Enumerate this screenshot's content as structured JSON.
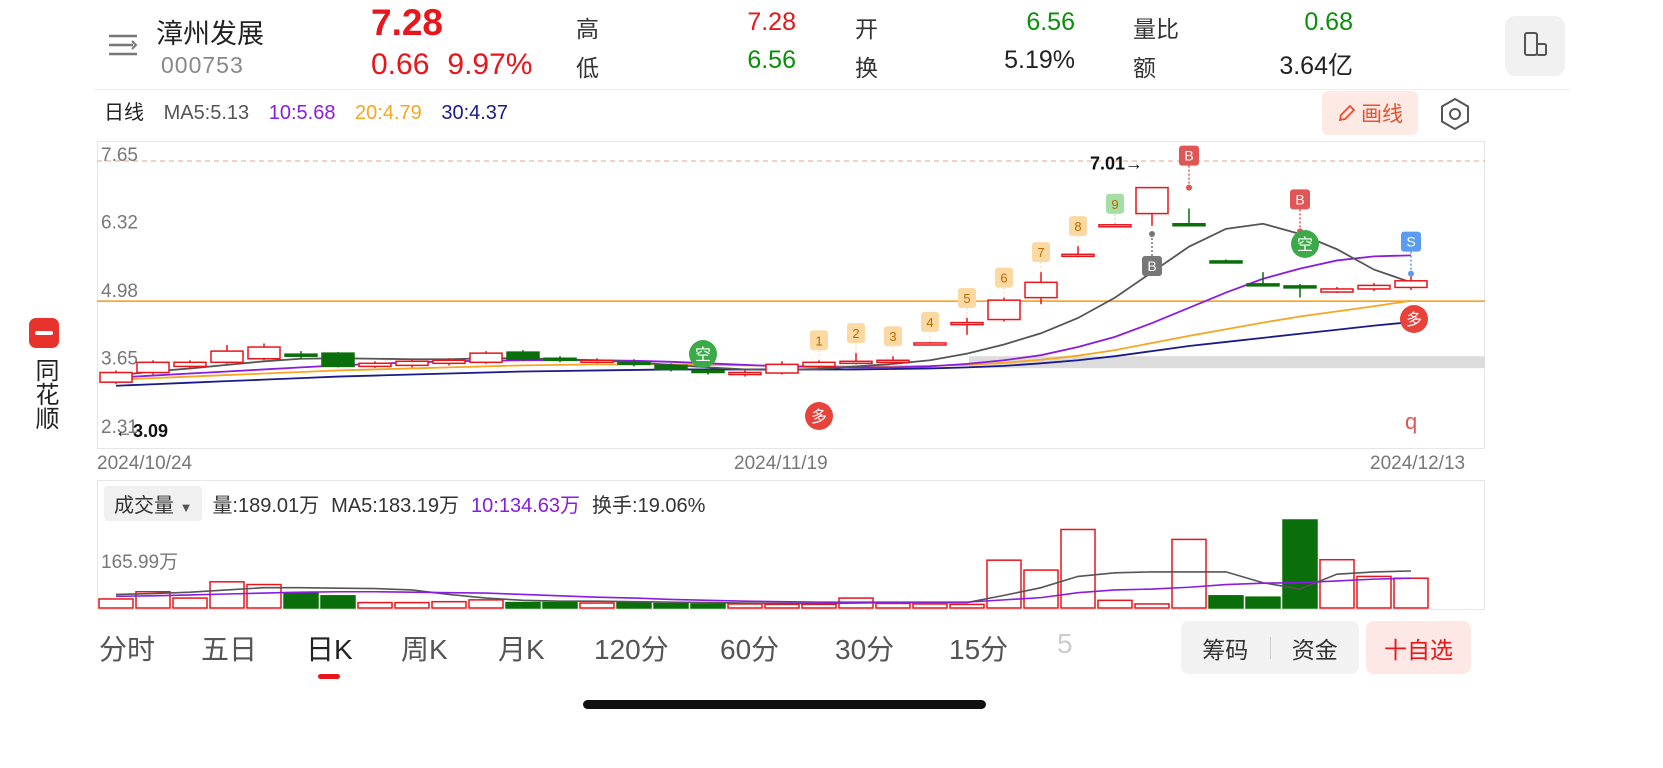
{
  "app": {
    "brand": "同花顺"
  },
  "stock": {
    "name": "漳州发展",
    "code": "000753",
    "price": "7.28",
    "change": "0.66",
    "change_pct": "9.97%",
    "quotes": [
      {
        "label": "高",
        "value": "7.28",
        "tone": "red"
      },
      {
        "label": "开",
        "value": "6.56",
        "tone": "green"
      },
      {
        "label": "量比",
        "value": "0.68",
        "tone": "green"
      },
      {
        "label": "低",
        "value": "6.56",
        "tone": "green"
      },
      {
        "label": "换",
        "value": "5.19%",
        "tone": "dark"
      },
      {
        "label": "额",
        "value": "3.64亿",
        "tone": "dark"
      }
    ]
  },
  "indicators": {
    "period_label": "日线",
    "ma5": "MA5:5.13",
    "ma10": "10:5.68",
    "ma20": "20:4.79",
    "ma30": "30:4.37"
  },
  "toolbar": {
    "draw_label": "画线"
  },
  "colors": {
    "up": "#e8151b",
    "down": "#0a6e0a",
    "ma5": "#555555",
    "ma10": "#8a1be0",
    "ma20": "#f5a623",
    "ma30": "#1a1a8c",
    "ref_line": "#f39c12"
  },
  "chart_data": {
    "type": "candlestick",
    "y_ticks": [
      "7.65",
      "6.32",
      "4.98",
      "3.65",
      "2.31"
    ],
    "ylim": [
      2.31,
      7.65
    ],
    "dates": [
      "2024/10/24",
      "2024/11/19",
      "2024/12/13"
    ],
    "max_annotation": "7.01→",
    "min_annotation": "←3.09",
    "ref_line_value": 4.78,
    "candles": [
      {
        "o": 3.19,
        "c": 3.38,
        "h": 3.42,
        "l": 3.15
      },
      {
        "o": 3.38,
        "c": 3.58,
        "h": 3.62,
        "l": 3.34
      },
      {
        "o": 3.5,
        "c": 3.58,
        "h": 3.62,
        "l": 3.45
      },
      {
        "o": 3.58,
        "c": 3.8,
        "h": 3.92,
        "l": 3.55
      },
      {
        "o": 3.65,
        "c": 3.88,
        "h": 3.95,
        "l": 3.62
      },
      {
        "o": 3.74,
        "c": 3.7,
        "h": 3.8,
        "l": 3.65
      },
      {
        "o": 3.76,
        "c": 3.5,
        "h": 3.78,
        "l": 3.48
      },
      {
        "o": 3.5,
        "c": 3.56,
        "h": 3.6,
        "l": 3.47
      },
      {
        "o": 3.52,
        "c": 3.6,
        "h": 3.64,
        "l": 3.48
      },
      {
        "o": 3.56,
        "c": 3.62,
        "h": 3.66,
        "l": 3.52
      },
      {
        "o": 3.58,
        "c": 3.76,
        "h": 3.8,
        "l": 3.55
      },
      {
        "o": 3.78,
        "c": 3.64,
        "h": 3.82,
        "l": 3.6
      },
      {
        "o": 3.66,
        "c": 3.63,
        "h": 3.7,
        "l": 3.58
      },
      {
        "o": 3.61,
        "c": 3.62,
        "h": 3.66,
        "l": 3.56
      },
      {
        "o": 3.58,
        "c": 3.54,
        "h": 3.64,
        "l": 3.5
      },
      {
        "o": 3.52,
        "c": 3.44,
        "h": 3.56,
        "l": 3.4
      },
      {
        "o": 3.42,
        "c": 3.38,
        "h": 3.46,
        "l": 3.34
      },
      {
        "o": 3.34,
        "c": 3.38,
        "h": 3.42,
        "l": 3.3
      },
      {
        "o": 3.37,
        "c": 3.54,
        "h": 3.6,
        "l": 3.34
      },
      {
        "o": 3.5,
        "c": 3.58,
        "h": 3.62,
        "l": 3.46
      },
      {
        "o": 3.56,
        "c": 3.6,
        "h": 3.76,
        "l": 3.54
      },
      {
        "o": 3.58,
        "c": 3.62,
        "h": 3.7,
        "l": 3.55
      },
      {
        "o": 3.92,
        "c": 3.96,
        "h": 3.98,
        "l": 3.92
      },
      {
        "o": 4.34,
        "c": 4.36,
        "h": 4.45,
        "l": 4.12
      },
      {
        "o": 4.42,
        "c": 4.8,
        "h": 4.85,
        "l": 4.38
      },
      {
        "o": 4.85,
        "c": 5.15,
        "h": 5.35,
        "l": 4.72
      },
      {
        "o": 5.68,
        "c": 5.7,
        "h": 5.86,
        "l": 5.64
      },
      {
        "o": 6.27,
        "c": 6.28,
        "h": 6.3,
        "l": 6.26
      },
      {
        "o": 6.5,
        "c": 7.01,
        "h": 7.01,
        "l": 6.26
      },
      {
        "o": 6.3,
        "c": 6.29,
        "h": 6.6,
        "l": 6.27
      },
      {
        "o": 5.57,
        "c": 5.56,
        "h": 5.6,
        "l": 5.55
      },
      {
        "o": 5.12,
        "c": 5.11,
        "h": 5.35,
        "l": 5.1
      },
      {
        "o": 5.08,
        "c": 5.07,
        "h": 5.12,
        "l": 4.85
      },
      {
        "o": 4.96,
        "c": 5.02,
        "h": 5.06,
        "l": 4.94
      },
      {
        "o": 5.02,
        "c": 5.09,
        "h": 5.14,
        "l": 4.98
      },
      {
        "o": 5.05,
        "c": 5.18,
        "h": 5.35,
        "l": 5.0
      }
    ],
    "ma5": [
      3.32,
      3.4,
      3.46,
      3.53,
      3.6,
      3.65,
      3.66,
      3.65,
      3.64,
      3.64,
      3.66,
      3.66,
      3.64,
      3.62,
      3.58,
      3.53,
      3.48,
      3.44,
      3.43,
      3.45,
      3.5,
      3.55,
      3.62,
      3.75,
      3.93,
      4.15,
      4.45,
      4.85,
      5.35,
      5.85,
      6.2,
      6.3,
      6.1,
      5.8,
      5.4,
      5.15
    ],
    "ma10": [
      3.28,
      3.32,
      3.36,
      3.4,
      3.44,
      3.48,
      3.52,
      3.55,
      3.58,
      3.6,
      3.61,
      3.62,
      3.62,
      3.62,
      3.61,
      3.59,
      3.56,
      3.53,
      3.5,
      3.49,
      3.48,
      3.48,
      3.5,
      3.55,
      3.62,
      3.72,
      3.88,
      4.08,
      4.35,
      4.65,
      4.95,
      5.22,
      5.42,
      5.58,
      5.66,
      5.68
    ],
    "ma20": [
      3.24,
      3.27,
      3.3,
      3.33,
      3.36,
      3.39,
      3.42,
      3.44,
      3.46,
      3.48,
      3.5,
      3.52,
      3.53,
      3.54,
      3.54,
      3.54,
      3.53,
      3.52,
      3.51,
      3.5,
      3.5,
      3.5,
      3.51,
      3.53,
      3.57,
      3.63,
      3.71,
      3.82,
      3.96,
      4.1,
      4.23,
      4.36,
      4.48,
      4.58,
      4.68,
      4.79
    ],
    "ma30": [
      3.12,
      3.15,
      3.18,
      3.21,
      3.24,
      3.27,
      3.3,
      3.32,
      3.34,
      3.36,
      3.38,
      3.4,
      3.41,
      3.42,
      3.43,
      3.44,
      3.44,
      3.44,
      3.44,
      3.44,
      3.44,
      3.45,
      3.46,
      3.48,
      3.51,
      3.56,
      3.62,
      3.7,
      3.8,
      3.9,
      3.98,
      4.06,
      4.14,
      4.22,
      4.3,
      4.37
    ],
    "signals": {
      "seq_labels": [
        "1",
        "2",
        "3",
        "4",
        "5",
        "6",
        "7",
        "8",
        "9"
      ],
      "seq_colors": [
        "#fcd9a3",
        "#fcd9a3",
        "#fcd9a3",
        "#fcd9a3",
        "#fcd9a3",
        "#fcd9a3",
        "#fcd9a3",
        "#fcd9a3",
        "#a5dfa5"
      ],
      "b_label": "B",
      "s_label": "S",
      "kong_label": "空",
      "duo_label": "多",
      "q_label": "q"
    },
    "volume": {
      "title": "成交量",
      "liang": "量:189.01万",
      "ma5": "MA5:183.19万",
      "ma10": "10:134.63万",
      "turnover": "换手:19.06%",
      "y_tick": "165.99万",
      "values": [
        20,
        36,
        22,
        58,
        52,
        34,
        27,
        12,
        12,
        14,
        18,
        12,
        12,
        11,
        12,
        10,
        9,
        9,
        8,
        8,
        22,
        10,
        9,
        8,
        106,
        84,
        174,
        17,
        9,
        152,
        27,
        24,
        195,
        107,
        70,
        66
      ],
      "up": [
        true,
        true,
        true,
        true,
        true,
        false,
        false,
        true,
        true,
        true,
        true,
        false,
        false,
        true,
        false,
        false,
        false,
        true,
        true,
        true,
        true,
        true,
        true,
        true,
        true,
        true,
        true,
        true,
        true,
        true,
        false,
        false,
        false,
        true,
        true,
        true
      ],
      "ma5_vol": [
        30,
        32,
        35,
        40,
        45,
        45,
        44,
        43,
        40,
        30,
        22,
        17,
        15,
        15,
        14,
        13,
        12,
        11,
        10,
        10,
        11,
        12,
        12,
        12,
        28,
        45,
        70,
        78,
        80,
        80,
        80,
        56,
        42,
        75,
        80,
        82
      ],
      "ma10_vol": [
        26,
        27,
        29,
        31,
        33,
        35,
        36,
        36,
        35,
        34,
        33,
        30,
        27,
        24,
        22,
        19,
        17,
        15,
        14,
        13,
        13,
        13,
        13,
        13,
        18,
        23,
        34,
        40,
        42,
        46,
        52,
        55,
        56,
        60,
        64,
        66
      ]
    }
  },
  "tabs": [
    "分时",
    "五日",
    "日K",
    "周K",
    "月K",
    "120分",
    "60分",
    "30分",
    "15分",
    "5"
  ],
  "active_tab": "日K",
  "bottom_buttons": {
    "chips": "筹码",
    "funds": "资金",
    "watchlist": "十自选"
  }
}
